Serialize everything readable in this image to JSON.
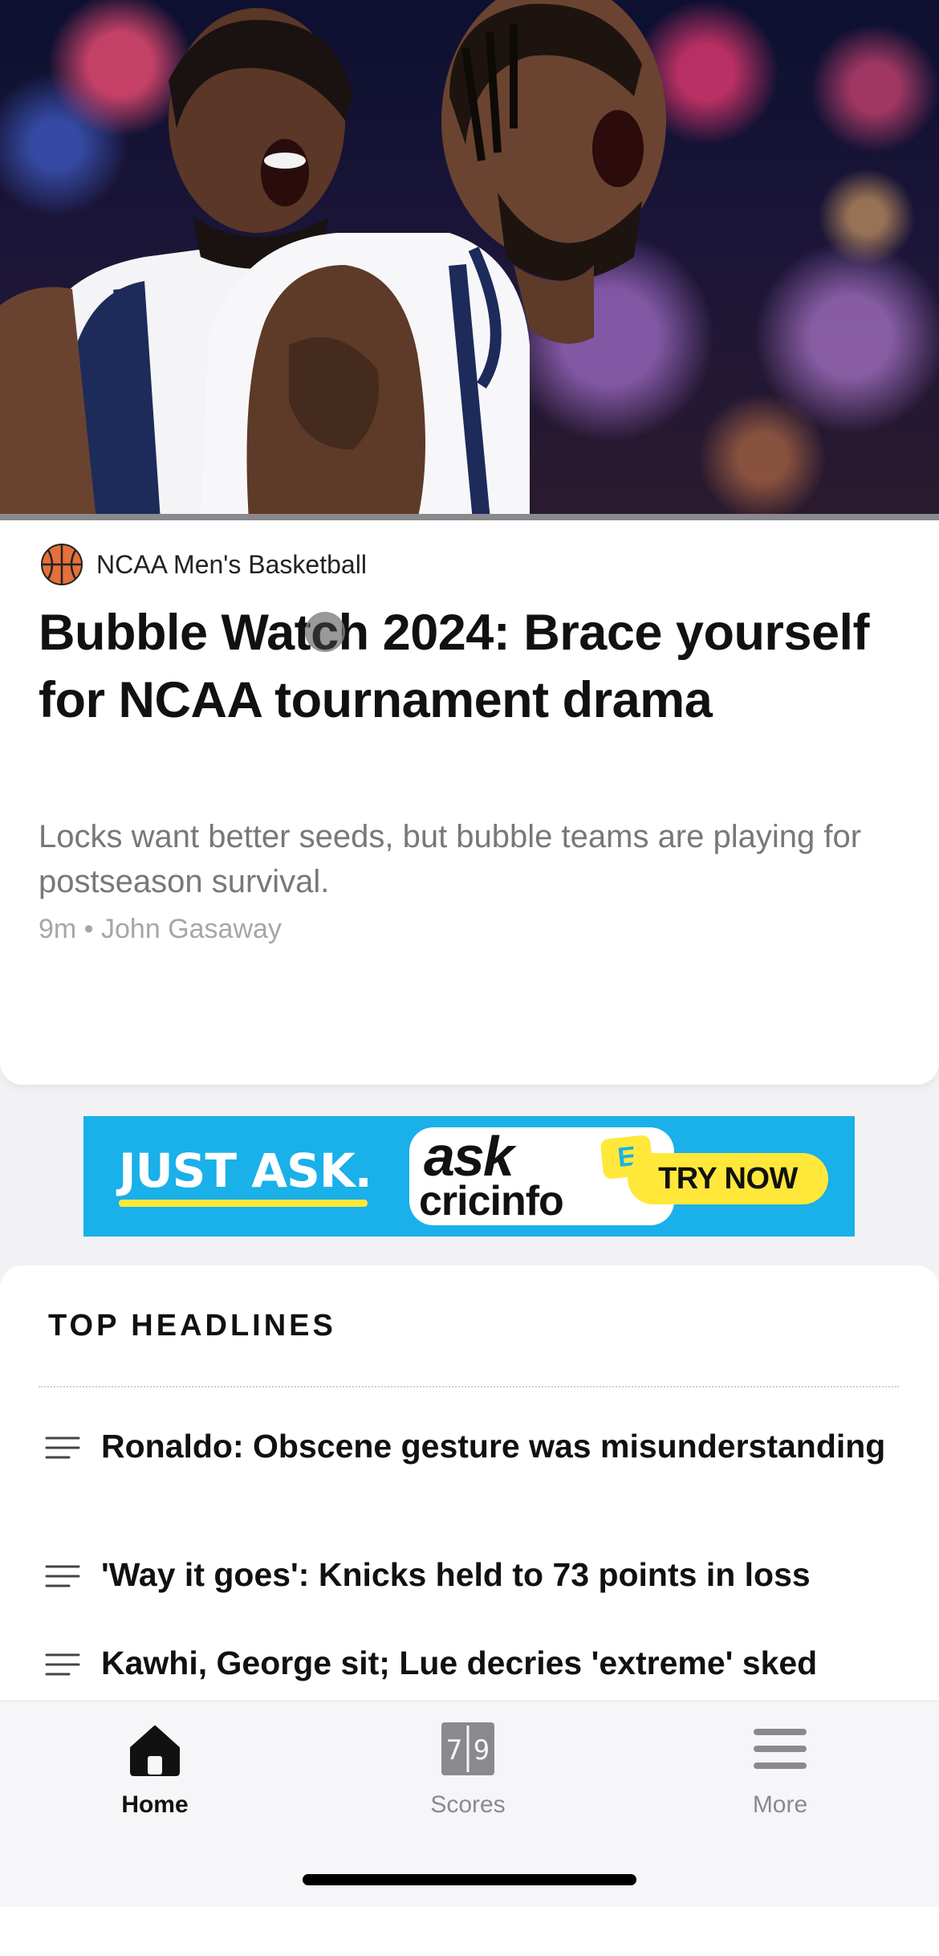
{
  "article": {
    "league": "NCAA Men's Basketball",
    "headline": "Bubble Watch 2024: Brace yourself for NCAA tournament drama",
    "summary": "Locks want better seeds, but bubble teams are playing for postseason survival.",
    "byline": "9m • John Gasaway"
  },
  "ad": {
    "tagline": "JUST ASK.",
    "logo_top": "ask",
    "logo_badge": "E",
    "logo_bottom": "cricinfo",
    "cta": "TRY NOW",
    "colors": {
      "background": "#1ab0ea",
      "accent": "#ffe83a"
    }
  },
  "top_headlines": {
    "title": "TOP HEADLINES",
    "items": [
      {
        "text": "Ronaldo: Obscene gesture was misunderstanding"
      },
      {
        "text": "'Way it goes': Knicks held to 73 points in loss"
      },
      {
        "text": "Kawhi, George sit; Lue decries 'extreme' sked"
      }
    ]
  },
  "tabbar": {
    "tabs": [
      {
        "label": "Home",
        "icon": "home-icon",
        "active": true
      },
      {
        "label": "Scores",
        "icon": "scoreboard-icon",
        "icon_digits": "79",
        "active": false
      },
      {
        "label": "More",
        "icon": "menu-icon",
        "active": false
      }
    ],
    "colors": {
      "active": "#111111",
      "inactive": "#8a8a8e"
    }
  }
}
